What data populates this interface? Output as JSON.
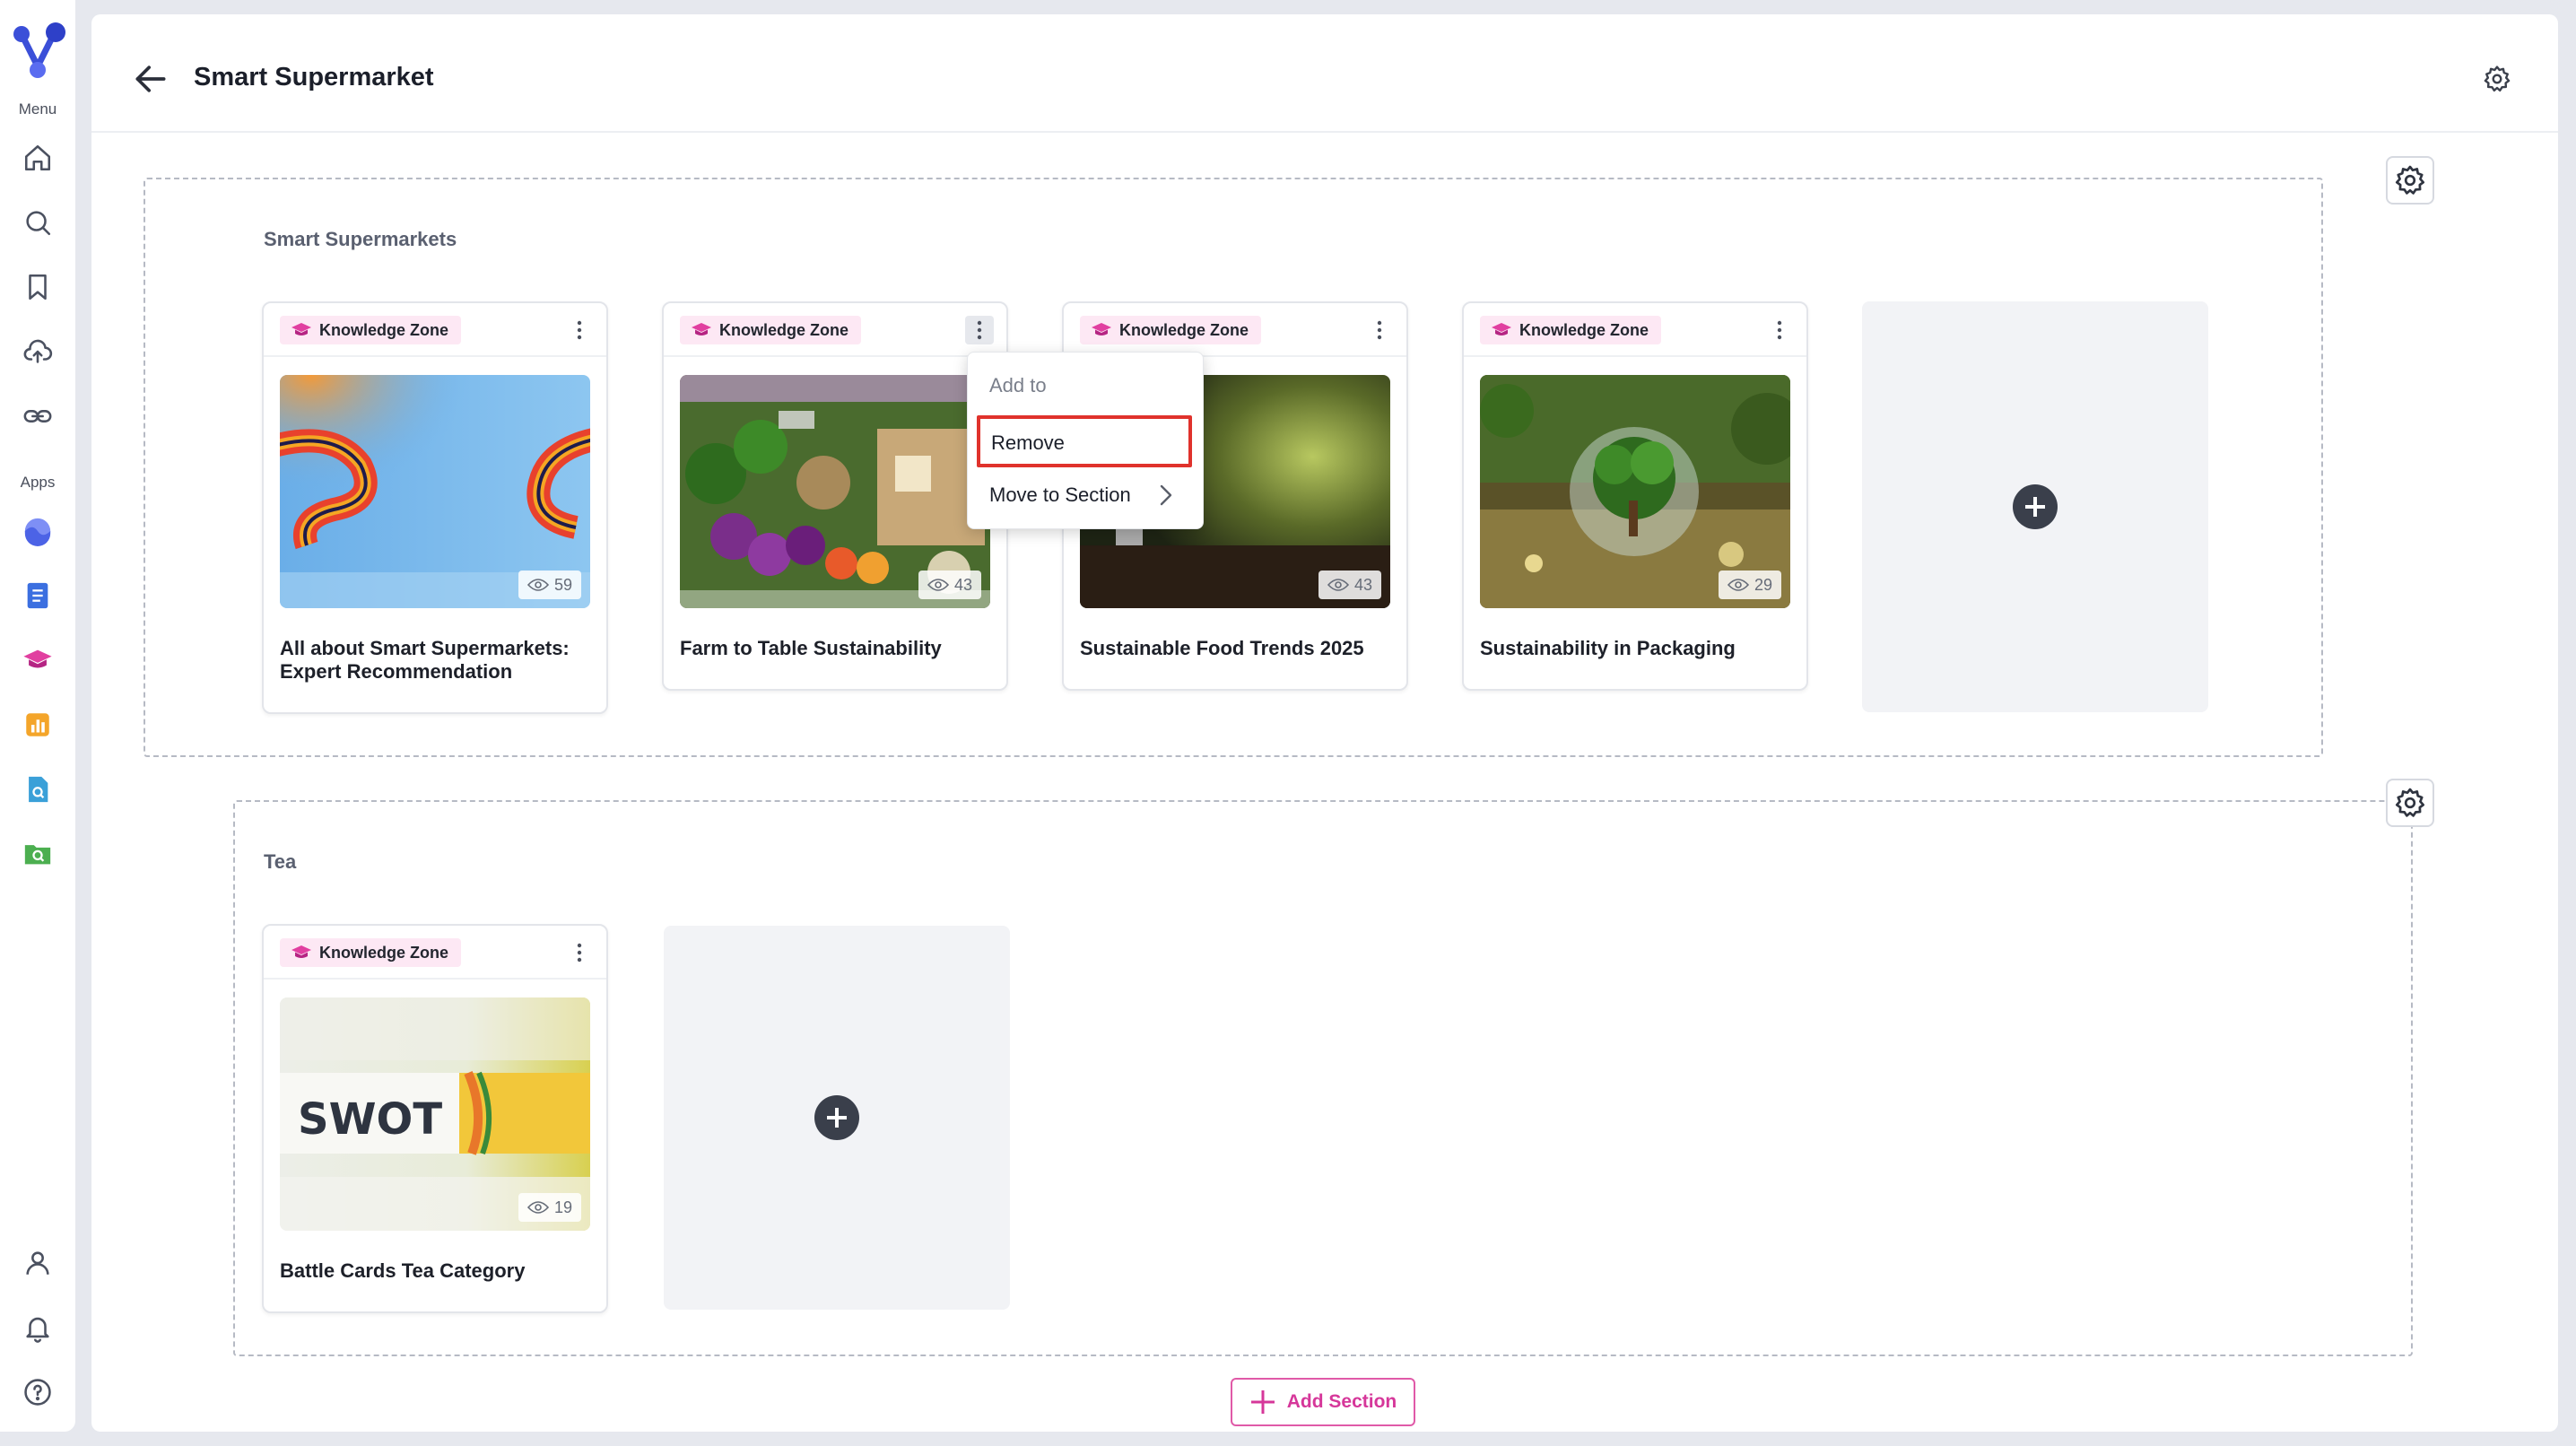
{
  "sidebar": {
    "menu_label": "Menu",
    "apps_label": "Apps"
  },
  "header": {
    "title": "Smart Supermarket"
  },
  "badge_label": "Knowledge Zone",
  "sections": [
    {
      "title": "Smart Supermarkets",
      "cards": [
        {
          "title": "All about Smart Supermarkets: Expert Recommendation",
          "views": "59"
        },
        {
          "title": "Farm to Table Sustainability",
          "views": "43"
        },
        {
          "title": "Sustainable Food Trends 2025",
          "views": "43"
        },
        {
          "title": "Sustainability in Packaging",
          "views": "29"
        }
      ]
    },
    {
      "title": "Tea",
      "cards": [
        {
          "title": "Battle Cards Tea Category",
          "views": "19"
        }
      ]
    }
  ],
  "context_menu": {
    "add_to": "Add to",
    "remove": "Remove",
    "move_to_section": "Move to Section"
  },
  "add_section_label": "Add Section",
  "thumb_text": {
    "swot": "SWOT"
  },
  "colors": {
    "accent_pink": "#d6379a",
    "badge_bg": "#fde8f4",
    "highlight_red": "#e0322c"
  }
}
